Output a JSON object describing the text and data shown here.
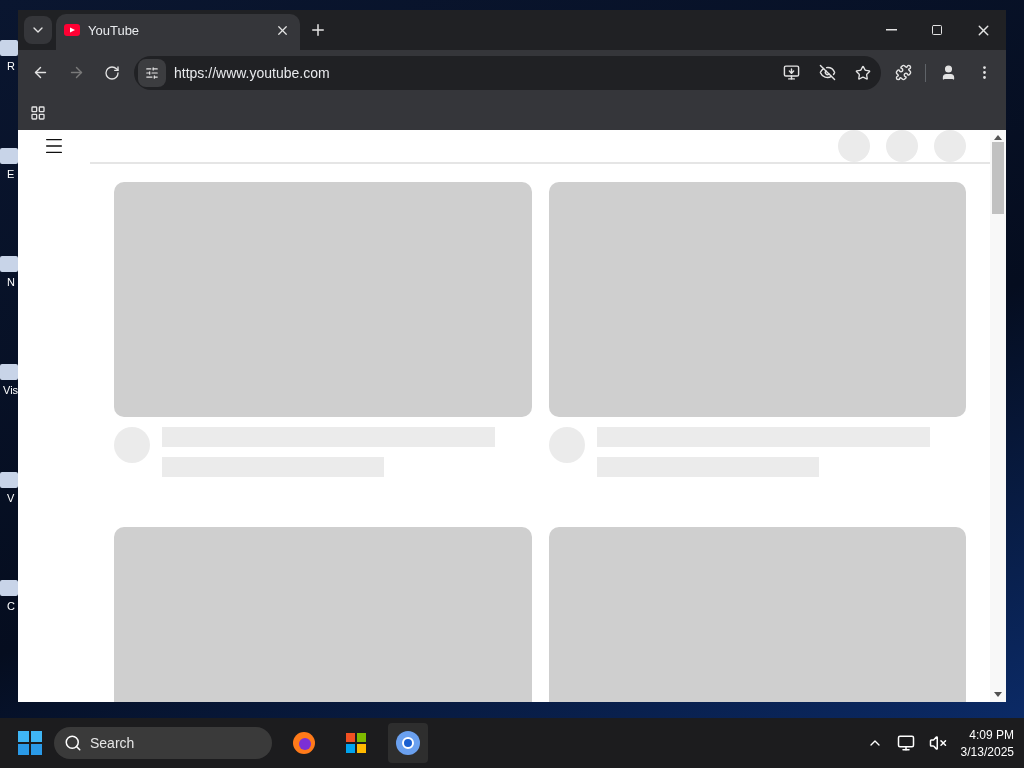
{
  "desktop_icons": [
    {
      "label": "R"
    },
    {
      "label": "E"
    },
    {
      "label": "N"
    },
    {
      "label": "Vis"
    },
    {
      "label": "V"
    },
    {
      "label": "C"
    }
  ],
  "browser": {
    "tabs": [
      {
        "title": "YouTube",
        "selected": true
      }
    ],
    "address": "https://www.youtube.com"
  },
  "taskbar": {
    "search": {
      "placeholder": "Search"
    },
    "time": "4:09 PM",
    "date": "3/13/2025"
  }
}
